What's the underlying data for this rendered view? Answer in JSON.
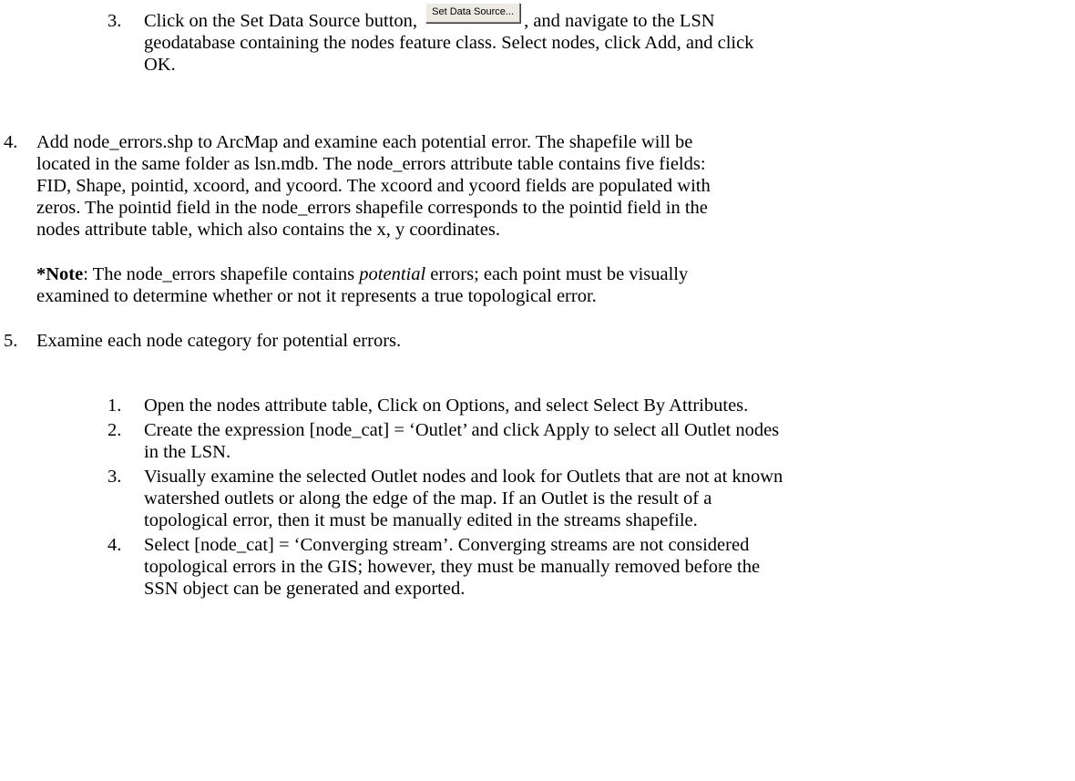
{
  "step3": {
    "number": "3.",
    "line1_before": "Click on the Set Data Source button,",
    "button_label": "Set Data Source...",
    "line1_after": ", and navigate to the LSN",
    "line2": "geodatabase containing the nodes feature class. Select nodes, click Add, and click",
    "line3": "OK."
  },
  "step4": {
    "number": "4.",
    "lines": [
      "Add node_errors.shp to ArcMap and examine each potential error. The shapefile will be",
      "located in the same folder as lsn.mdb. The node_errors attribute table contains five fields:",
      "FID, Shape, pointid, xcoord, and ycoord. The xcoord and ycoord fields are populated with",
      "zeros. The pointid field in the node_errors shapefile corresponds to the pointid field in the",
      "nodes attribute table, which also contains the x, y coordinates."
    ]
  },
  "note": {
    "label": "*Note",
    "line1_before": ": The node_errors shapefile contains ",
    "line1_italic": "potential",
    "line1_after": " errors; each point must be visually",
    "line2": "examined to determine whether or not it represents a true topological error."
  },
  "step5": {
    "number": "5.",
    "text": "Examine each node category for potential errors.",
    "subitems": [
      {
        "number": "1.",
        "lines": [
          "Open the nodes attribute table, Click on Options, and select Select By Attributes."
        ]
      },
      {
        "number": "2.",
        "lines": [
          "Create the expression [node_cat] = ‘Outlet’ and click Apply to select all Outlet nodes",
          "in the LSN."
        ]
      },
      {
        "number": "3.",
        "lines": [
          "Visually examine the selected Outlet nodes and look for Outlets that are not at known",
          "watershed outlets or along the edge of the map. If an Outlet is the result of a",
          "topological error, then it must be manually edited in the streams shapefile."
        ]
      },
      {
        "number": "4.",
        "lines": [
          "Select [node_cat] = ‘Converging stream’. Converging streams are not considered",
          "topological errors in the GIS; however, they must be manually removed before the",
          "SSN object can be generated and exported."
        ]
      }
    ]
  }
}
